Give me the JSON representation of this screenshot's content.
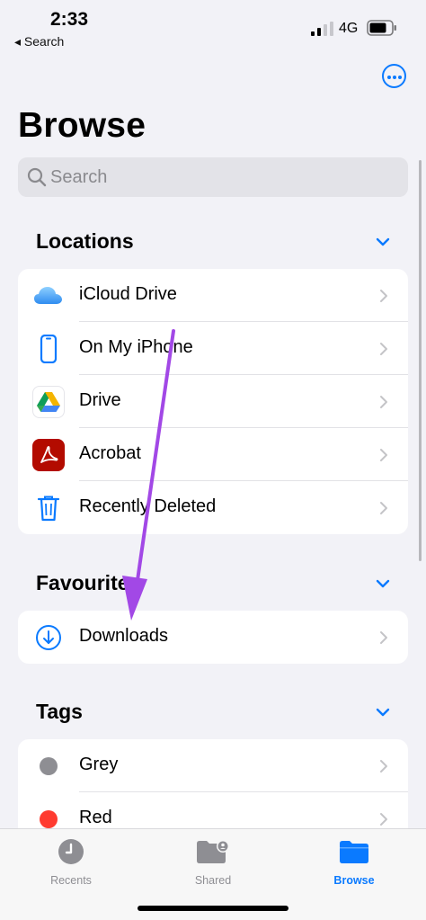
{
  "status_bar": {
    "time": "2:33",
    "back_label": "◂ Search",
    "network": "4G"
  },
  "header": {
    "title": "Browse",
    "search_placeholder": "Search",
    "more_icon": "ellipsis-circle-icon"
  },
  "colors": {
    "accent": "#0a7aff",
    "arrow": "#a248e6",
    "background": "#f2f2f7"
  },
  "sections": {
    "locations": {
      "label": "Locations",
      "items": [
        {
          "label": "iCloud Drive",
          "icon": "icloud-icon"
        },
        {
          "label": "On My iPhone",
          "icon": "iphone-icon"
        },
        {
          "label": "Drive",
          "icon": "google-drive-icon"
        },
        {
          "label": "Acrobat",
          "icon": "acrobat-icon"
        },
        {
          "label": "Recently Deleted",
          "icon": "trash-icon"
        }
      ]
    },
    "favourites": {
      "label": "Favourites",
      "items": [
        {
          "label": "Downloads",
          "icon": "download-circle-icon"
        }
      ]
    },
    "tags": {
      "label": "Tags",
      "items": [
        {
          "label": "Grey",
          "color": "#8e8e93"
        },
        {
          "label": "Red",
          "color": "#ff3b30"
        }
      ]
    }
  },
  "tabbar": {
    "recents": "Recents",
    "shared": "Shared",
    "browse": "Browse",
    "active": "browse"
  }
}
